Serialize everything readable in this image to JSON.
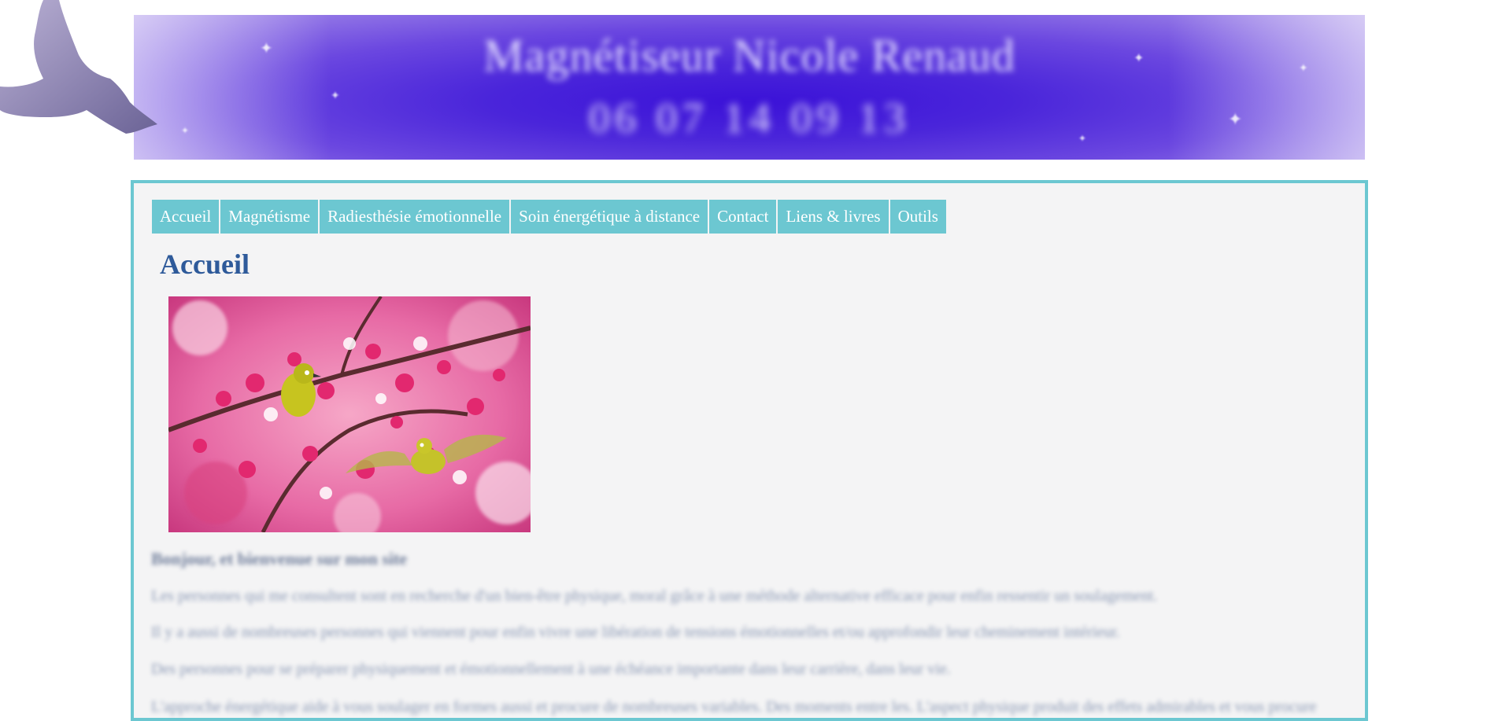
{
  "banner": {
    "title": "Magnétiseur Nicole Renaud",
    "phone": "06 07 14 09 13"
  },
  "nav": {
    "items": [
      {
        "label": "Accueil"
      },
      {
        "label": "Magnétisme"
      },
      {
        "label": "Radiesthésie émotionnelle"
      },
      {
        "label": "Soin énergétique à distance"
      },
      {
        "label": "Contact"
      },
      {
        "label": "Liens & livres"
      },
      {
        "label": "Outils"
      }
    ]
  },
  "main": {
    "title": "Accueil",
    "image_icon": "cherry-blossom-birds-photo",
    "intro_heading": "Bonjour, et bienvenue sur mon site",
    "paragraphs": [
      "Les personnes qui me consultent sont en recherche d'un bien-être physique, moral grâce à une méthode alternative efficace pour enfin ressentir un soulagement.",
      "Il y a aussi de nombreuses personnes qui viennent pour enfin vivre une libération de tensions émotionnelles et/ou approfondir leur cheminement intérieur.",
      "Des personnes pour se préparer physiquement et émotionnellement à une échéance importante dans leur carrière, dans leur vie.",
      "L'approche énergétique aide à vous soulager en formes aussi et procure de nombreuses variables. Des moments entre les. L'aspect physique produit des effets admirables et vous procure"
    ]
  },
  "colors": {
    "accent": "#6cc7d1",
    "title": "#2e5a9a",
    "banner": "#3b12d8"
  }
}
